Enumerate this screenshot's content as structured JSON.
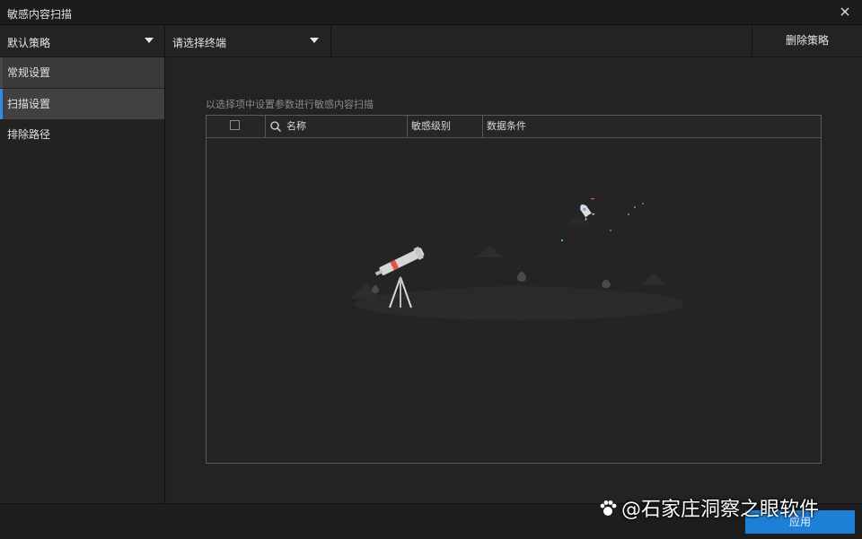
{
  "window": {
    "title": "敏感内容扫描"
  },
  "toolbar": {
    "policy_select": "默认策略",
    "terminal_select": "请选择终端",
    "delete_label": "删除策略"
  },
  "sidebar": {
    "items": [
      {
        "label": "常规设置"
      },
      {
        "label": "扫描设置"
      },
      {
        "label": "排除路径"
      }
    ]
  },
  "main": {
    "hint": "以选择项中设置参数进行敏感内容扫描",
    "table": {
      "columns": [
        "名称",
        "敏感级别",
        "数据条件"
      ]
    }
  },
  "footer": {
    "apply_label": "应用"
  },
  "watermark": {
    "text": "@石家庄洞察之眼软件"
  },
  "colors": {
    "accent": "#1d80d6",
    "active_indicator": "#2f8ce0"
  }
}
